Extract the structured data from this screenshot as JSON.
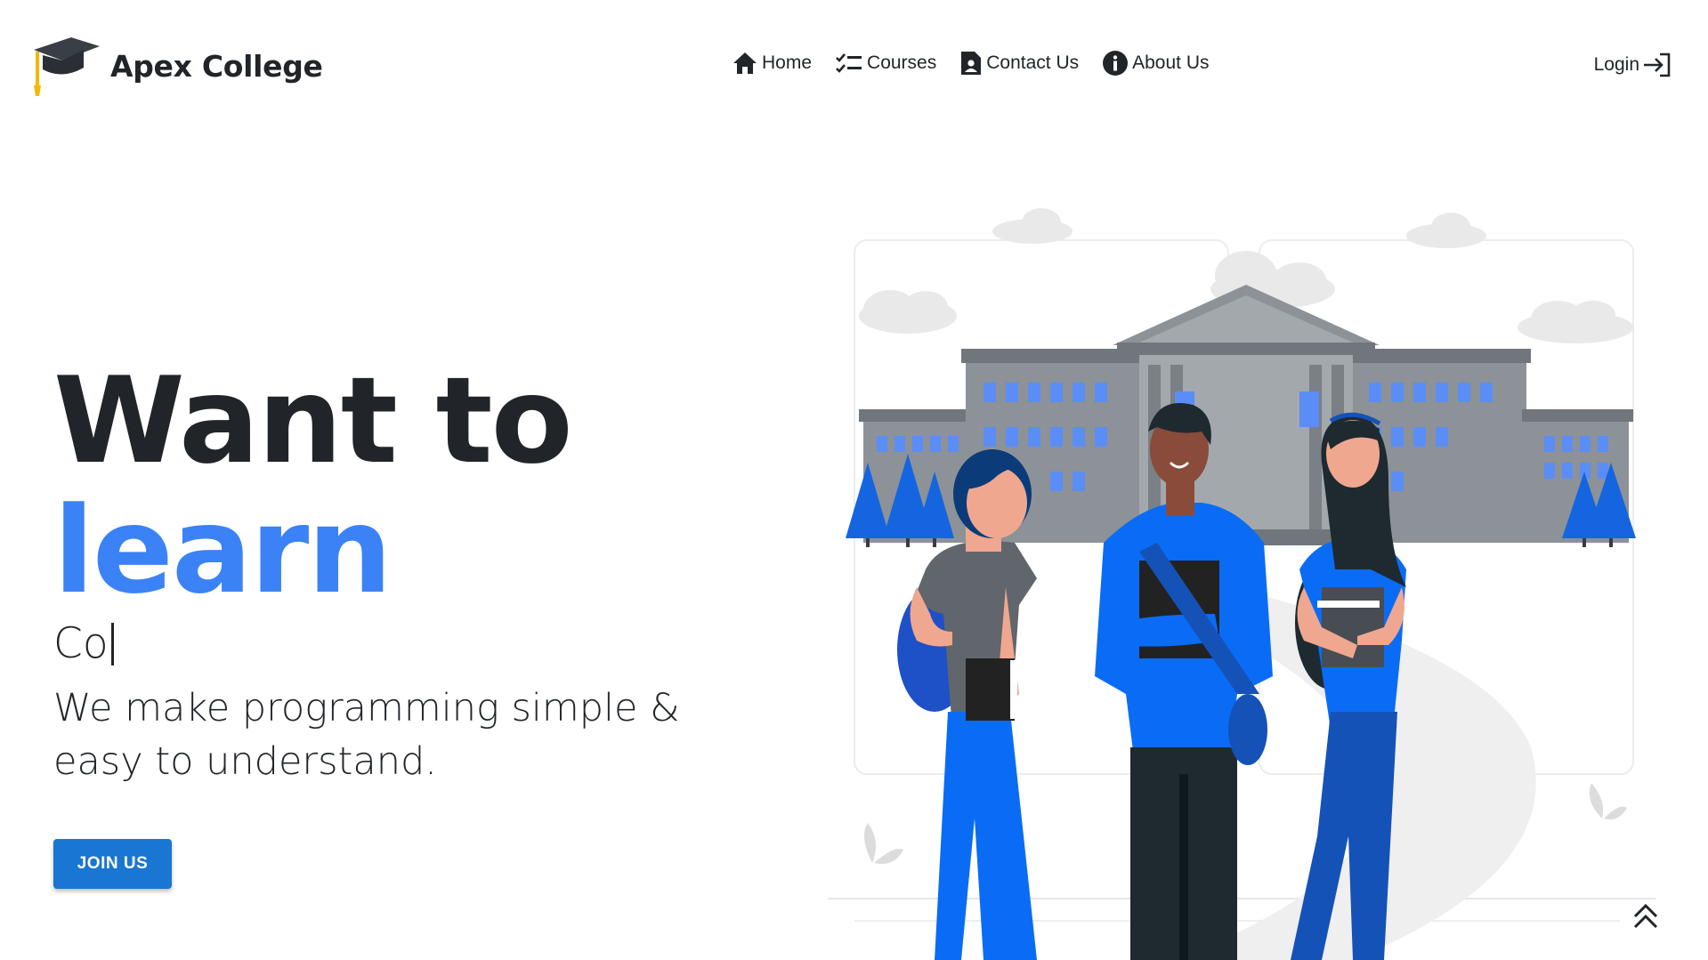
{
  "brand": {
    "name": "Apex College",
    "logo_icon": "graduation-cap-icon"
  },
  "nav": {
    "items": [
      {
        "label": "Home",
        "icon": "home-icon"
      },
      {
        "label": "Courses",
        "icon": "checklist-icon"
      },
      {
        "label": "Contact Us",
        "icon": "contact-card-icon"
      },
      {
        "label": "About Us",
        "icon": "info-icon"
      }
    ],
    "login": {
      "label": "Login",
      "icon": "login-arrow-icon"
    }
  },
  "hero": {
    "line1": "Want to",
    "line2": "learn",
    "typed_text": "Co",
    "tagline": "We make programming simple & easy to understand.",
    "cta_label": "JOIN US"
  },
  "colors": {
    "accent": "#3b82f6",
    "button": "#1976d2",
    "text": "#212529",
    "cap_tassel": "#f5b800"
  },
  "scroll_top_icon": "double-chevron-up-icon"
}
